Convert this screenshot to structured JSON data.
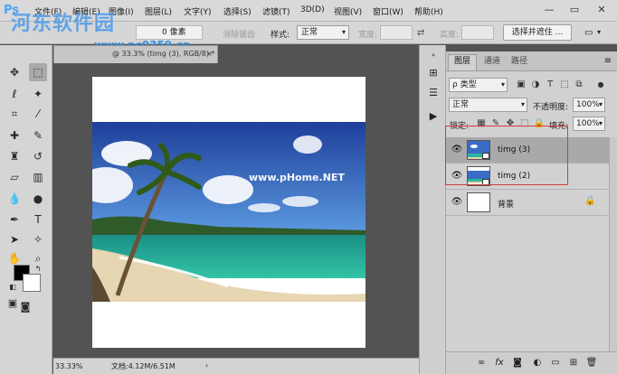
{
  "app": {
    "logo": "Ps",
    "watermark_text": "河东软件园",
    "watermark_url": "www.pc0359.cn",
    "photo_watermark": "www.pHome.NET"
  },
  "menubar": {
    "items": [
      "文件(F)",
      "编辑(E)",
      "图像(I)",
      "图层(L)",
      "文字(Y)",
      "选择(S)",
      "滤镜(T)",
      "3D(D)",
      "视图(V)",
      "窗口(W)",
      "帮助(H)"
    ],
    "window_controls": {
      "minimize": "—",
      "restore": "▭",
      "close": "✕"
    }
  },
  "options_bar": {
    "feather_value": "0 像素",
    "antialias_label": "消除锯齿",
    "style_label": "样式:",
    "style_value": "正常",
    "width_label": "宽度:",
    "height_label": "高度:",
    "select_mask_button": "选择并遮住 ..."
  },
  "document": {
    "tab_label": "@ 33.3% (timg (3), RGB/8) *",
    "tab_close": "×",
    "zoom": "33.33%",
    "doc_size": "文档:4.12M/6.51M"
  },
  "layers_panel": {
    "tabs": [
      "图层",
      "通道",
      "路径"
    ],
    "active_tab": 0,
    "filter_kind": "ρ 类型",
    "blend_mode": "正常",
    "opacity_label": "不透明度:",
    "opacity_value": "100%",
    "lock_label": "锁定:",
    "fill_label": "填充:",
    "fill_value": "100%",
    "layers": [
      {
        "name": "timg (3)",
        "visible": true,
        "selected": true,
        "locked": false,
        "kind": "smart-photo"
      },
      {
        "name": "timg (2)",
        "visible": true,
        "selected": false,
        "locked": false,
        "kind": "smart-photo"
      },
      {
        "name": "背景",
        "visible": true,
        "selected": false,
        "locked": true,
        "kind": "white"
      }
    ]
  },
  "colors": {
    "foreground": "#000000",
    "background": "#ffffff",
    "selection_highlight": "#d83a3a"
  }
}
